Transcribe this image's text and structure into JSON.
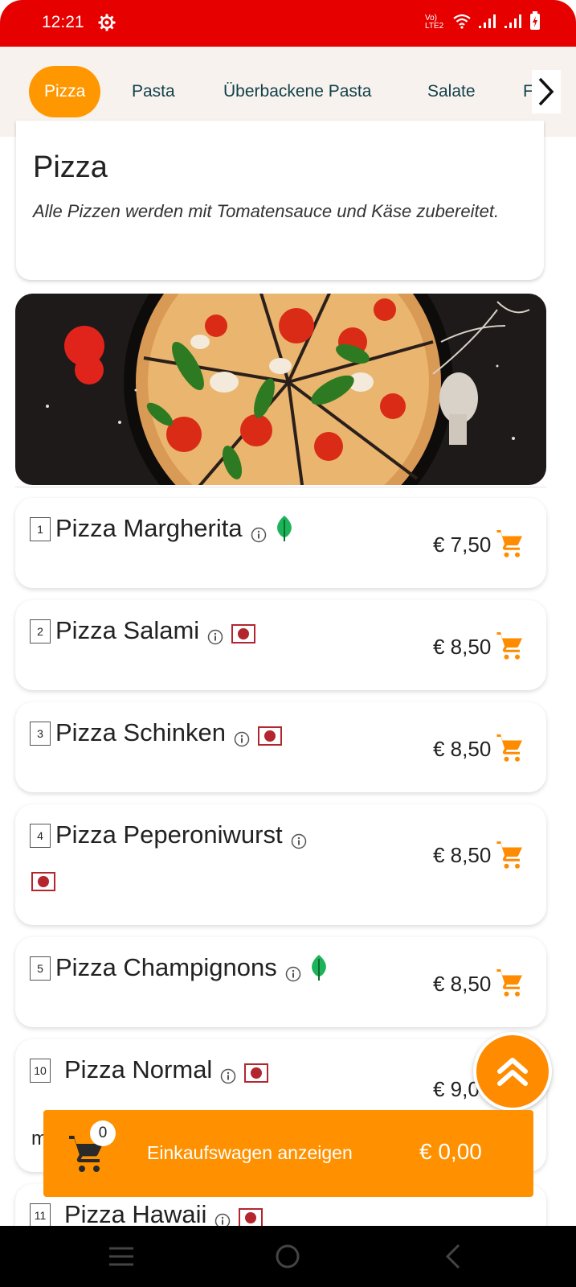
{
  "status": {
    "time": "12:21",
    "network_label": "Vo) LTE2"
  },
  "categories": [
    "Pizza",
    "Pasta",
    "Überbackene Pasta",
    "Salate",
    "F"
  ],
  "section": {
    "title": "Pizza",
    "description": "Alle Pizzen werden mit Tomatensauce und Käse zubereitet."
  },
  "products": [
    {
      "num": "1",
      "name": "Pizza Margherita",
      "badge": "veg-leaf-icon",
      "price": "€ 7,50"
    },
    {
      "num": "2",
      "name": "Pizza Salami",
      "badge": "meat-badge-icon",
      "price": "€ 8,50"
    },
    {
      "num": "3",
      "name": "Pizza Schinken",
      "badge": "meat-badge-icon",
      "price": "€ 8,50"
    },
    {
      "num": "4",
      "name": "Pizza Peperoniwurst",
      "badge": "meat-badge-icon",
      "price": "€ 8,50"
    },
    {
      "num": "5",
      "name": "Pizza Champignons",
      "badge": "veg-leaf-icon",
      "price": "€ 8,50"
    },
    {
      "num": "10",
      "name": "Pizza Normal",
      "badge": "meat-badge-icon",
      "price": "€ 9,0",
      "extra": "m"
    },
    {
      "num": "11",
      "name": "Pizza Hawaii",
      "badge": "meat-badge-icon"
    }
  ],
  "cart_bar": {
    "count": "0",
    "label": "Einkaufswagen anzeigen",
    "total": "€ 0,00"
  },
  "colors": {
    "status_bar": "#e60000",
    "accent": "#ff9800",
    "category_text": "#114149",
    "meat_badge": "#b3262e",
    "veg_leaf": "#1db35a"
  }
}
